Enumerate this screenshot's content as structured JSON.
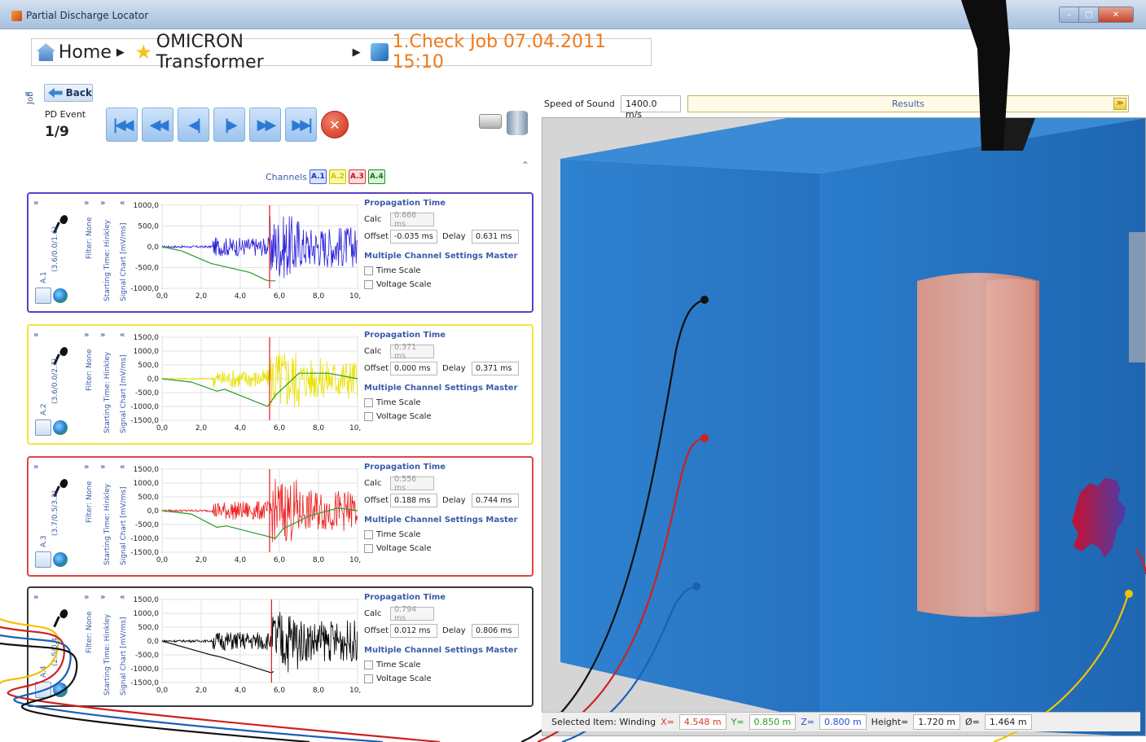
{
  "window": {
    "title": "Partial Discharge Locator",
    "min": "–",
    "max": "□",
    "close": "✕"
  },
  "breadcrumb": {
    "home": "Home",
    "sep": "▶",
    "transformer": "OMICRON Transformer",
    "job": "1.Check Job 07.04.2011 15:10"
  },
  "left": {
    "job_label": "Job",
    "back": "Back",
    "expand": "»",
    "pd_event_label": "PD Event",
    "pd_event_count": "1/9",
    "nav_icons": [
      "first-icon",
      "rewind-icon",
      "step-back-icon",
      "step-forward-icon",
      "fast-forward-icon",
      "last-icon",
      "close-icon"
    ],
    "nav_glyphs": [
      "|◀◀",
      "◀◀",
      "◀|",
      "|▶",
      "▶▶",
      "▶▶|",
      "✕"
    ],
    "collapse": "«",
    "collapse_up": "⌃",
    "channels_label": "Channels",
    "channel_buttons": [
      "A.1",
      "A.2",
      "A.3",
      "A.4"
    ]
  },
  "panels": [
    {
      "name": "A.1",
      "pos": "(3.6/0.0/1.6)",
      "color": "#5a3fc9",
      "signal_color": "#2b1fd9",
      "filter": "Filter: None",
      "starting": "Starting Time: Hinkley",
      "chart_label": "Signal Chart [mV/ms]",
      "prop_title": "Propagation Time",
      "calc_label": "Calc",
      "calc": "0.666 ms",
      "offset_label": "Offset",
      "offset": "-0.035 ms",
      "delay_label": "Delay",
      "delay": "0.631 ms",
      "master": "Multiple Channel Settings Master",
      "time_scale": "Time Scale",
      "voltage_scale": "Voltage Scale"
    },
    {
      "name": "A.2",
      "pos": "(3.6/0.0/2.7)",
      "color": "#f3e53a",
      "signal_color": "#e8e200",
      "filter": "Filter: None",
      "starting": "Starting Time: Hinkley",
      "chart_label": "Signal Chart [mV/ms]",
      "prop_title": "Propagation Time",
      "calc_label": "Calc",
      "calc": "0.371 ms",
      "offset_label": "Offset",
      "offset": "0.000 ms",
      "delay_label": "Delay",
      "delay": "0.371 ms",
      "master": "Multiple Channel Settings Master",
      "time_scale": "Time Scale",
      "voltage_scale": "Voltage Scale"
    },
    {
      "name": "A.3",
      "pos": "(3.7/0.5/3.3)",
      "color": "#e04646",
      "signal_color": "#ee1f1f",
      "filter": "Filter: None",
      "starting": "Starting Time: Hinkley",
      "chart_label": "Signal Chart [mV/ms]",
      "prop_title": "Propagation Time",
      "calc_label": "Calc",
      "calc": "0.556 ms",
      "offset_label": "Offset",
      "offset": "0.188 ms",
      "delay_label": "Delay",
      "delay": "0.744 ms",
      "master": "Multiple Channel Settings Master",
      "time_scale": "Time Scale",
      "voltage_scale": "Voltage Scale"
    },
    {
      "name": "A.4",
      "pos": "(2.5/0.4/",
      "color": "#3a3a3a",
      "signal_color": "#000000",
      "filter": "Filter: None",
      "starting": "Starting Time: Hinkley",
      "chart_label": "Signal Chart [mV/ms]",
      "prop_title": "Propagation Time",
      "calc_label": "Calc",
      "calc": "0.794 ms",
      "offset_label": "Offset",
      "offset": "0.012 ms",
      "delay_label": "Delay",
      "delay": "0.806 ms",
      "master": "Multiple Channel Settings Master",
      "time_scale": "Time Scale",
      "voltage_scale": "Voltage Scale"
    }
  ],
  "chart_data": [
    {
      "type": "line",
      "series_name": "A.1",
      "x": [
        0,
        2,
        4,
        6,
        8,
        10
      ],
      "xlim": [
        0,
        10
      ],
      "ylim": [
        -1000,
        1000
      ],
      "y_ticks": [
        "1000,0",
        "500,0",
        "0,0",
        "-500,0",
        "-1000,0"
      ],
      "x_ticks": [
        "0,0",
        "2,0",
        "4,0",
        "6,0",
        "8,0",
        "10,0"
      ],
      "marker_x": 5.5,
      "envelope": [
        [
          0,
          0
        ],
        [
          1,
          -100
        ],
        [
          2.5,
          -400
        ],
        [
          4.5,
          -620
        ],
        [
          5.3,
          -800
        ],
        [
          5.5,
          -820
        ],
        [
          5.8,
          -820
        ]
      ]
    },
    {
      "type": "line",
      "series_name": "A.2",
      "x": [
        0,
        2,
        4,
        6,
        8,
        10
      ],
      "xlim": [
        0,
        10
      ],
      "ylim": [
        -1500,
        1500
      ],
      "y_ticks": [
        "1500,0",
        "1000,0",
        "500,0",
        "0,0",
        "-500,0",
        "-1000,0",
        "-1500,0"
      ],
      "x_ticks": [
        "0,0",
        "2,0",
        "4,0",
        "6,0",
        "8,0",
        "10,0"
      ],
      "marker_x": 5.5,
      "envelope": [
        [
          0,
          0
        ],
        [
          1.5,
          -120
        ],
        [
          2.8,
          -450
        ],
        [
          3.2,
          -380
        ],
        [
          5.4,
          -1000
        ],
        [
          5.8,
          -600
        ],
        [
          7,
          200
        ],
        [
          8.5,
          200
        ],
        [
          10,
          0
        ]
      ]
    },
    {
      "type": "line",
      "series_name": "A.3",
      "x": [
        0,
        2,
        4,
        6,
        8,
        10
      ],
      "xlim": [
        0,
        10
      ],
      "ylim": [
        -1500,
        1500
      ],
      "y_ticks": [
        "1500,0",
        "1000,0",
        "500,0",
        "0,0",
        "-500,0",
        "-1000,0",
        "-1500,0"
      ],
      "x_ticks": [
        "0,0",
        "2,0",
        "4,0",
        "6,0",
        "8,0",
        "10,0"
      ],
      "marker_x": 5.5,
      "envelope": [
        [
          0,
          0
        ],
        [
          1.5,
          -120
        ],
        [
          2.8,
          -600
        ],
        [
          3.3,
          -550
        ],
        [
          5.8,
          -1000
        ],
        [
          6.2,
          -650
        ],
        [
          7.5,
          -200
        ],
        [
          9,
          100
        ],
        [
          10,
          0
        ]
      ]
    },
    {
      "type": "line",
      "series_name": "A.4",
      "x": [
        0,
        2,
        4,
        6,
        8,
        10
      ],
      "xlim": [
        0,
        10
      ],
      "ylim": [
        -1500,
        1500
      ],
      "y_ticks": [
        "1500,0",
        "1000,0",
        "500,0",
        "0,0",
        "-500,0",
        "-1000,0",
        "-1500,0"
      ],
      "x_ticks": [
        "0,0",
        "2,0",
        "4,0",
        "6,0",
        "8,0",
        "10,0"
      ],
      "marker_x": 5.6,
      "envelope": [
        [
          0,
          0
        ],
        [
          2.5,
          -500
        ],
        [
          3,
          -580
        ],
        [
          5.6,
          -1150
        ],
        [
          5.7,
          -1100
        ]
      ]
    }
  ],
  "view": {
    "speed_label": "Speed of Sound",
    "speed_value": "1400.0 m/s",
    "results": "Results",
    "results_dd": "≫"
  },
  "status": {
    "selected": "Selected Item: Winding",
    "x_label": "X=",
    "x": "4.548 m",
    "y_label": "Y=",
    "y": "0.850 m",
    "z_label": "Z=",
    "z": "0.800 m",
    "h_label": "Height=",
    "h": "1.720 m",
    "d_label": "Ø=",
    "d": "1.464 m"
  },
  "colors": {
    "accent": "#3b5ba8",
    "tank": "#2a78c8",
    "winding": "#f08c72",
    "discharge": "#c8102e"
  }
}
